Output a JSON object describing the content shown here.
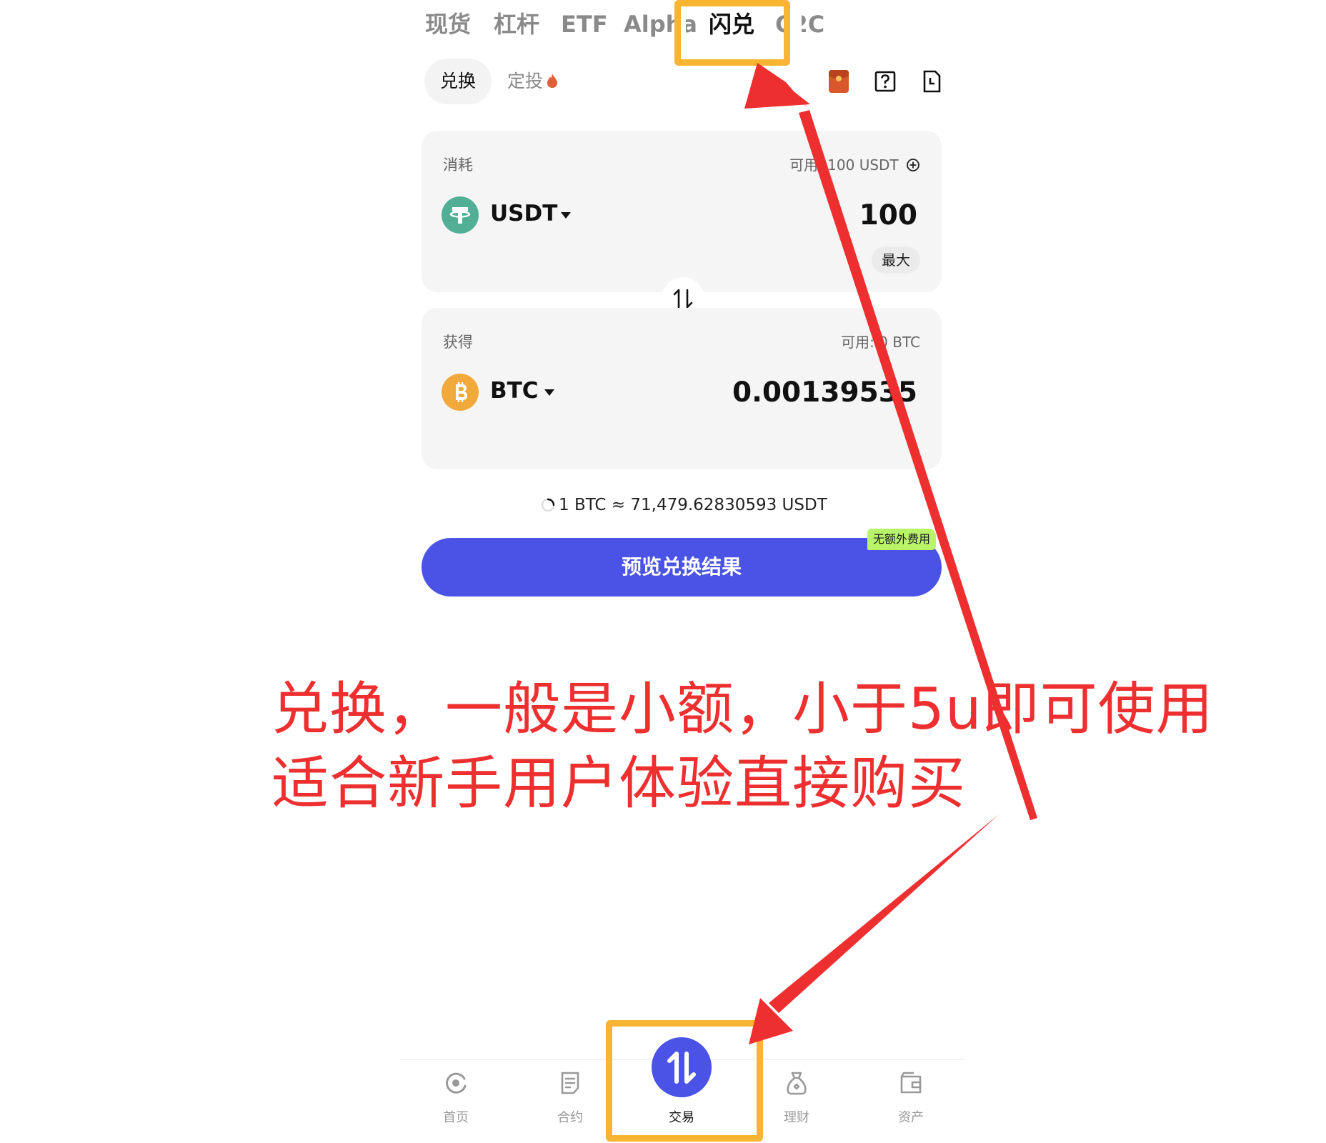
{
  "top_tabs": [
    {
      "label": "现货",
      "active": false
    },
    {
      "label": "杠杆",
      "active": false
    },
    {
      "label": "ETF",
      "active": false
    },
    {
      "label": "Alpha",
      "active": false
    },
    {
      "label": "闪兑",
      "active": true
    },
    {
      "label": "C2C",
      "active": false
    }
  ],
  "sub_tabs": [
    {
      "label": "兑换",
      "active": true
    },
    {
      "label": "定投",
      "active": false
    }
  ],
  "header_icons": [
    "red-packet-icon",
    "help-icon",
    "order-history-icon"
  ],
  "from_card": {
    "label": "消耗",
    "available": "可用: 100 USDT",
    "coin": "USDT",
    "coin_icon": "tether-icon",
    "amount": "100",
    "max_label": "最大"
  },
  "to_card": {
    "label": "获得",
    "available": "可用: 0 BTC",
    "coin": "BTC",
    "coin_icon": "bitcoin-icon",
    "amount": "0.00139535"
  },
  "rate": "1 BTC ≈ 71,479.62830593 USDT",
  "badge": "无额外费用",
  "cta_label": "预览兑换结果",
  "annotation": {
    "line1": "兑换，一般是小额，小于5u即可使用",
    "line2": "适合新手用户体验直接购买"
  },
  "bottom_nav": [
    {
      "label": "首页",
      "icon": "home-icon",
      "active": false
    },
    {
      "label": "合约",
      "icon": "contract-icon",
      "active": false
    },
    {
      "label": "交易",
      "icon": "trade-swap-icon",
      "active": true
    },
    {
      "label": "理财",
      "icon": "earn-icon",
      "active": false
    },
    {
      "label": "资产",
      "icon": "wallet-icon",
      "active": false
    }
  ],
  "colors": {
    "accent": "#4a53e5",
    "highlight": "#f7b531",
    "annotation": "#ee2f2f",
    "badge": "#b8f36a",
    "tether": "#50af95",
    "bitcoin": "#f2a93b"
  }
}
